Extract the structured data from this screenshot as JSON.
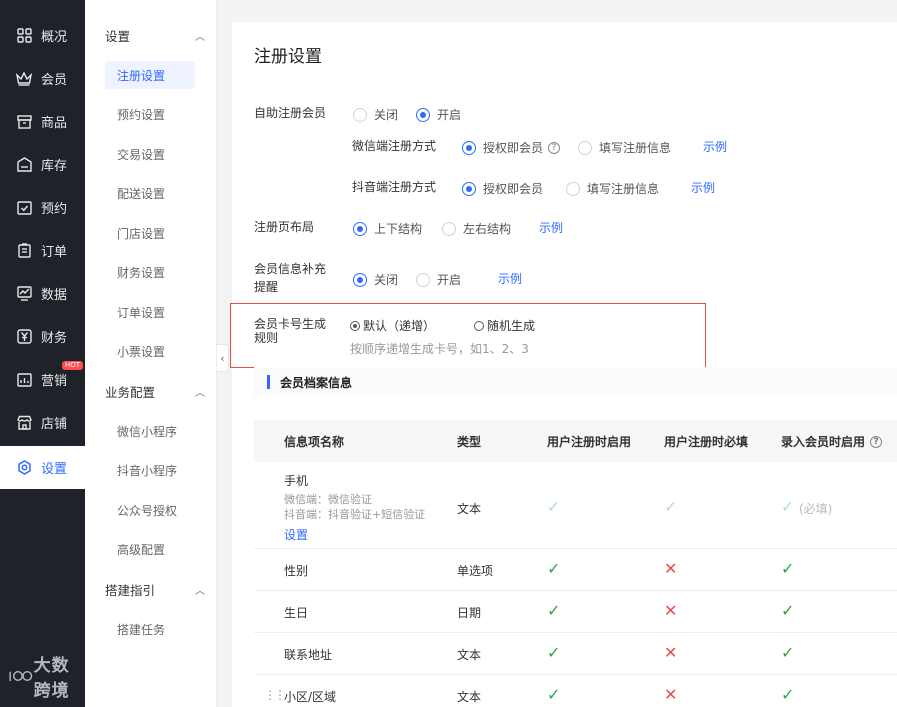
{
  "nav": {
    "items": [
      {
        "label": "概况",
        "icon": "grid-icon"
      },
      {
        "label": "会员",
        "icon": "crown-icon"
      },
      {
        "label": "商品",
        "icon": "store-icon"
      },
      {
        "label": "库存",
        "icon": "inventory-icon"
      },
      {
        "label": "预约",
        "icon": "calendar-check-icon"
      },
      {
        "label": "订单",
        "icon": "order-icon"
      },
      {
        "label": "数据",
        "icon": "chart-icon"
      },
      {
        "label": "财务",
        "icon": "yen-icon"
      },
      {
        "label": "营销",
        "icon": "marketing-icon",
        "badge": "HOT"
      },
      {
        "label": "店铺",
        "icon": "shop-icon"
      },
      {
        "label": "设置",
        "icon": "gear-icon",
        "active": true
      }
    ],
    "watermark": "大数跨境"
  },
  "submenu": {
    "group_settings": "设置",
    "settings_items": [
      "注册设置",
      "预约设置",
      "交易设置",
      "配送设置",
      "门店设置",
      "财务设置",
      "订单设置",
      "小票设置"
    ],
    "group_business": "业务配置",
    "business_items": [
      "微信小程序",
      "抖音小程序",
      "公众号授权",
      "高级配置"
    ],
    "group_guide": "搭建指引",
    "guide_items": [
      "搭建任务"
    ]
  },
  "page": {
    "title": "注册设置",
    "self_register": {
      "label": "自助注册会员",
      "off": "关闭",
      "on": "开启"
    },
    "wechat": {
      "label": "微信端注册方式",
      "opt1": "授权即会员",
      "opt2": "填写注册信息",
      "example": "示例"
    },
    "douyin": {
      "label": "抖音端注册方式",
      "opt1": "授权即会员",
      "opt2": "填写注册信息",
      "example": "示例"
    },
    "layout": {
      "label": "注册页布局",
      "opt1": "上下结构",
      "opt2": "左右结构",
      "example": "示例"
    },
    "remind": {
      "label_line1": "会员信息补充",
      "label_line2": "提醒",
      "off": "关闭",
      "on": "开启",
      "example": "示例"
    },
    "cardno": {
      "label_line1": "会员卡号生成",
      "label_line2": "规则",
      "opt1": "默认（递增）",
      "opt2": "随机生成",
      "hint": "按顺序递增生成卡号，如1、2、3"
    },
    "section_title": "会员档案信息"
  },
  "table": {
    "headers": [
      "信息项名称",
      "类型",
      "用户注册时启用",
      "用户注册时必填",
      "录入会员时启用"
    ],
    "rows": [
      {
        "name": "手机",
        "note1": "微信端：微信验证",
        "note2": "抖音端：抖音验证+短信验证",
        "link": "设置",
        "type": "文本",
        "required_text": "(必填)"
      },
      {
        "name": "性别",
        "type": "单选项"
      },
      {
        "name": "生日",
        "type": "日期"
      },
      {
        "name": "联系地址",
        "type": "文本"
      },
      {
        "name": "小区/区域",
        "type": "文本"
      }
    ]
  },
  "colors": {
    "accent": "#2f6bff",
    "nav_bg": "#1f2229",
    "check_green": "#2ea44f",
    "cross_red": "#e54d4d",
    "highlight_border": "#d9534f"
  }
}
